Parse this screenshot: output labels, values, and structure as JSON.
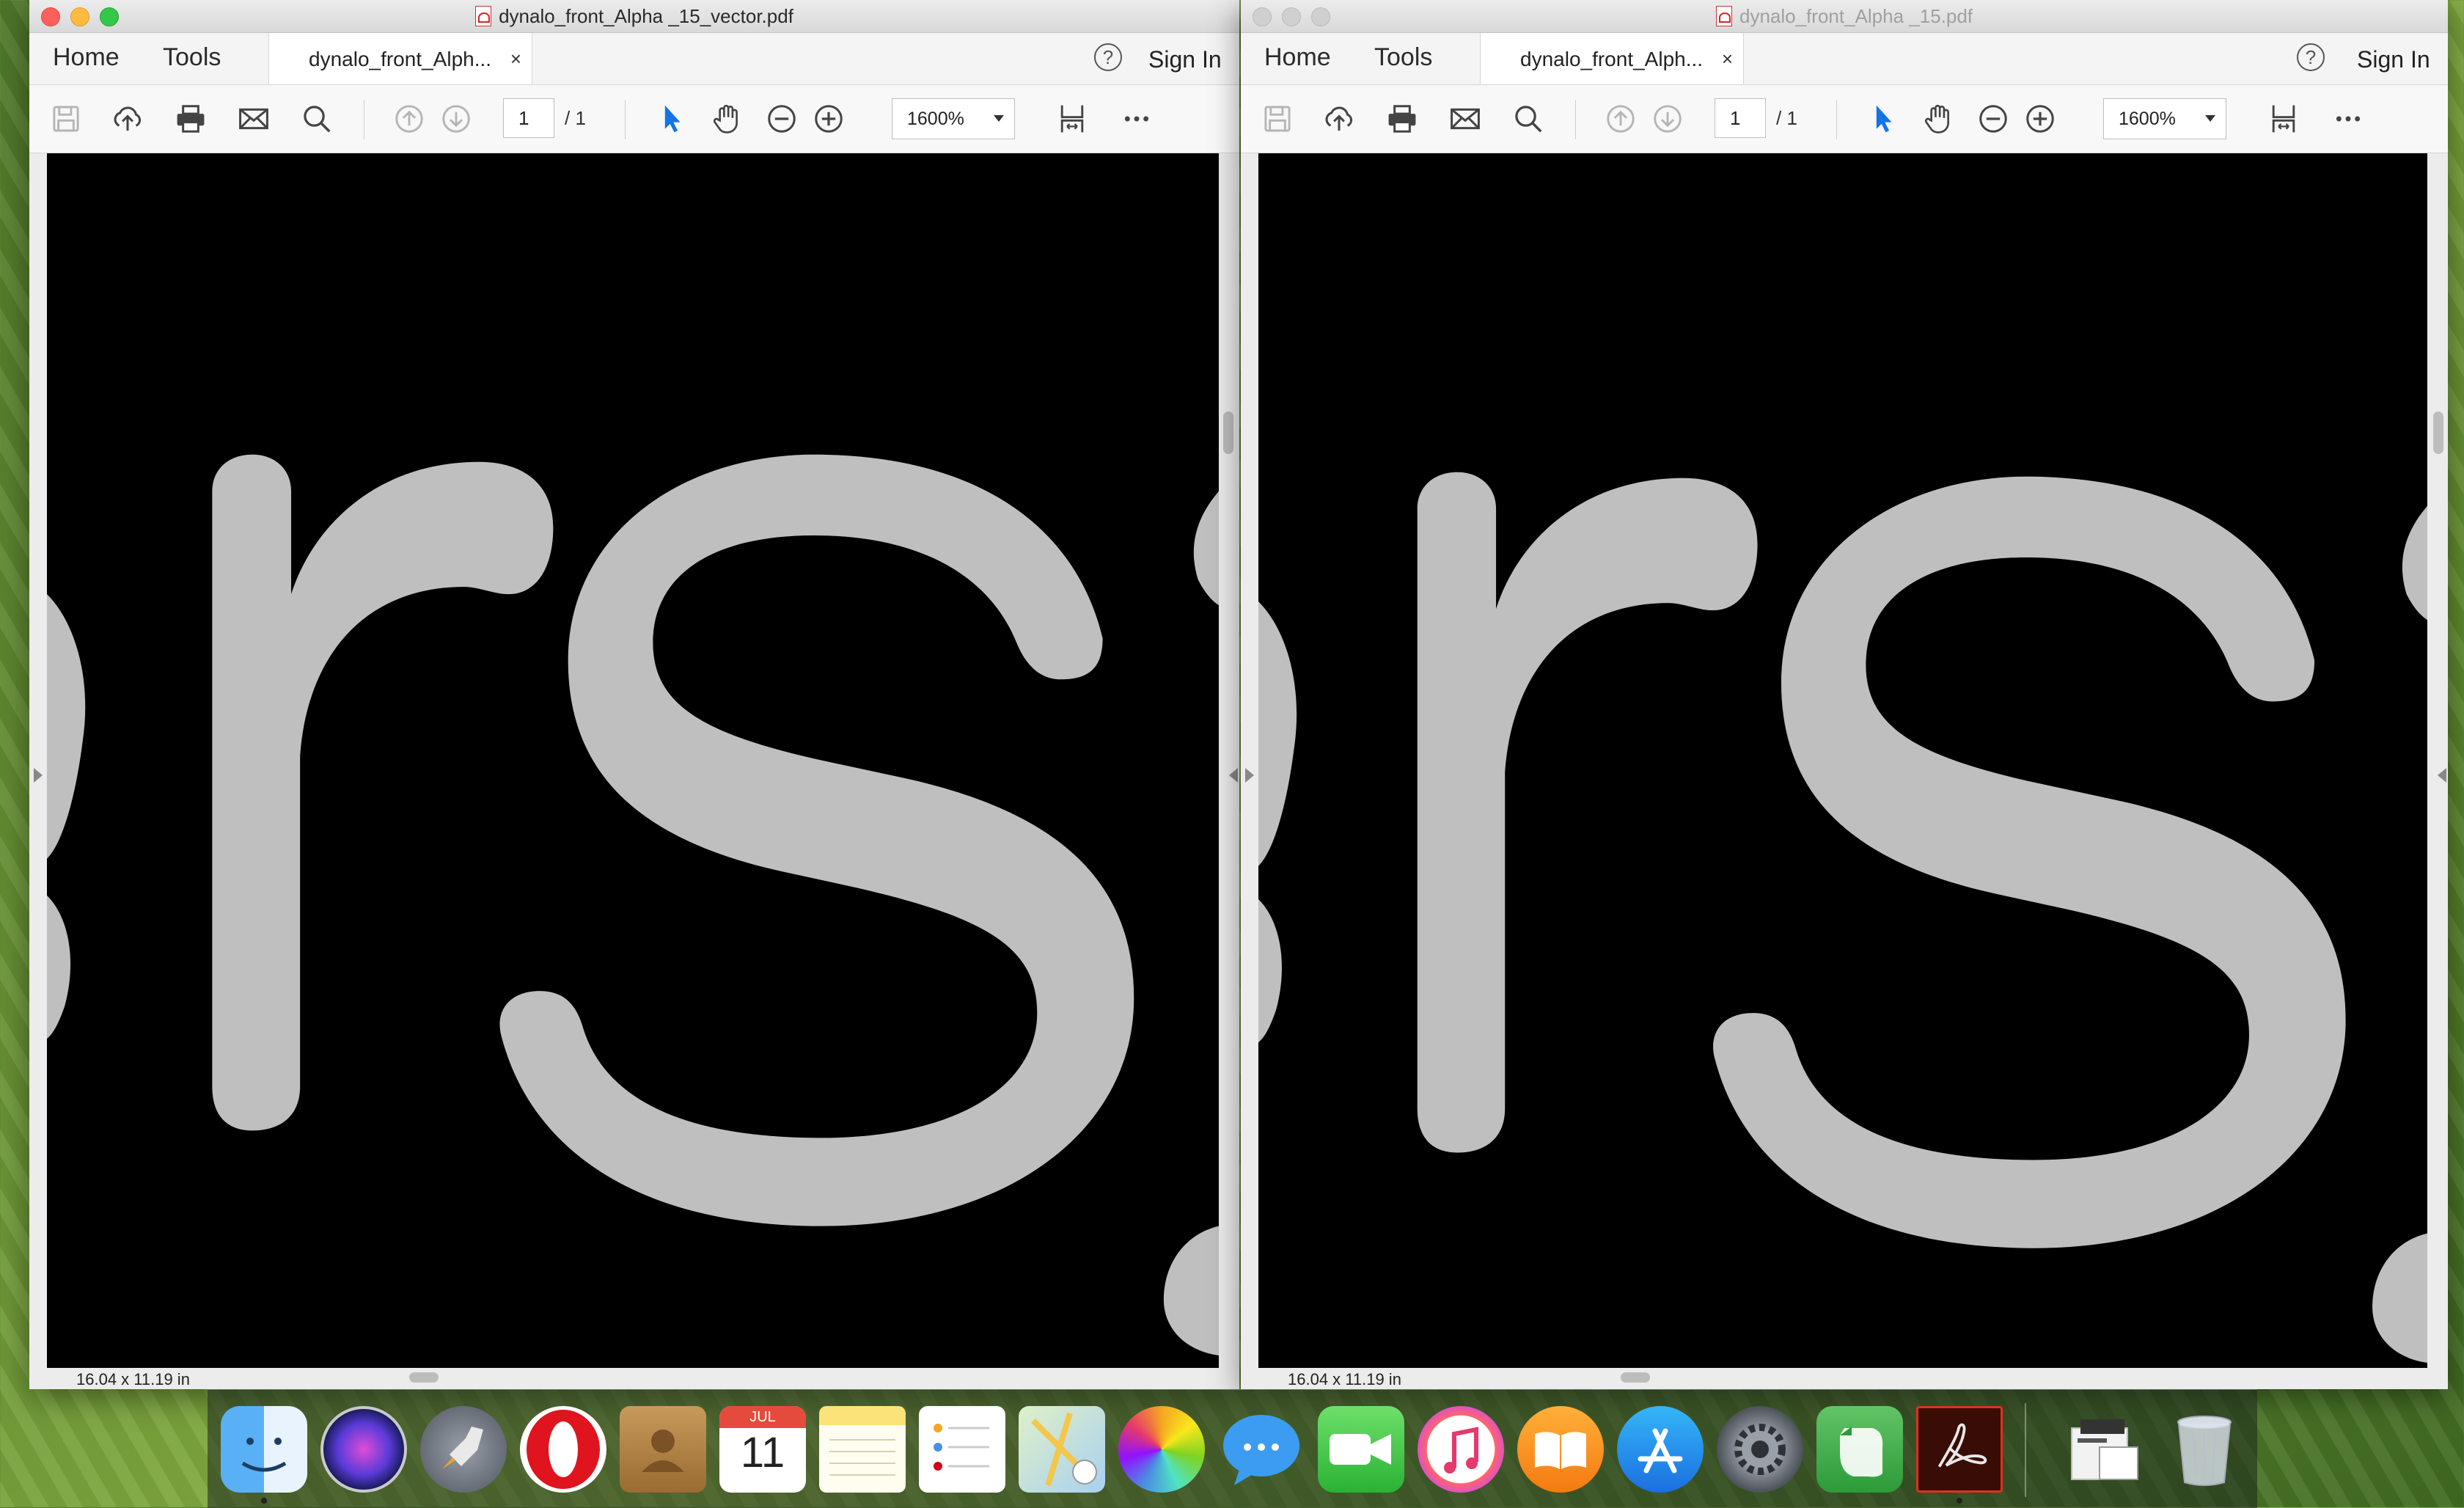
{
  "windows": {
    "left": {
      "title": "dynalo_front_Alpha _15_vector.pdf",
      "active": true,
      "tabs": {
        "home": "Home",
        "tools": "Tools"
      },
      "doc_tab": {
        "label": "dynalo_front_Alph...",
        "close": "×"
      },
      "help": "?",
      "sign_in": "Sign In",
      "page": {
        "current": "1",
        "total": "/ 1"
      },
      "zoom": "1600%",
      "page_size": "16.04 x 11.19 in"
    },
    "right": {
      "title": "dynalo_front_Alpha _15.pdf",
      "active": false,
      "tabs": {
        "home": "Home",
        "tools": "Tools"
      },
      "doc_tab": {
        "label": "dynalo_front_Alph...",
        "close": "×"
      },
      "help": "?",
      "sign_in": "Sign In",
      "page": {
        "current": "1",
        "total": "/ 1"
      },
      "zoom": "1600%",
      "page_size": "16.04 x 11.19 in"
    }
  },
  "canvas": {
    "glyphs": "rs",
    "glyph_color": "#bfbfbf",
    "background": "#000000"
  },
  "dock": {
    "calendar": {
      "month": "JUL",
      "day": "11"
    },
    "items": [
      "finder",
      "siri",
      "launchpad",
      "opera",
      "contacts",
      "calendar",
      "notes",
      "reminders",
      "maps",
      "photos",
      "messages",
      "facetime",
      "itunes",
      "ibooks",
      "app-store",
      "system-preferences",
      "evernote",
      "acrobat",
      "preview-pdf",
      "trash"
    ]
  },
  "colors": {
    "accent_blue": "#1473e6",
    "acrobat_red": "#b30b00"
  }
}
